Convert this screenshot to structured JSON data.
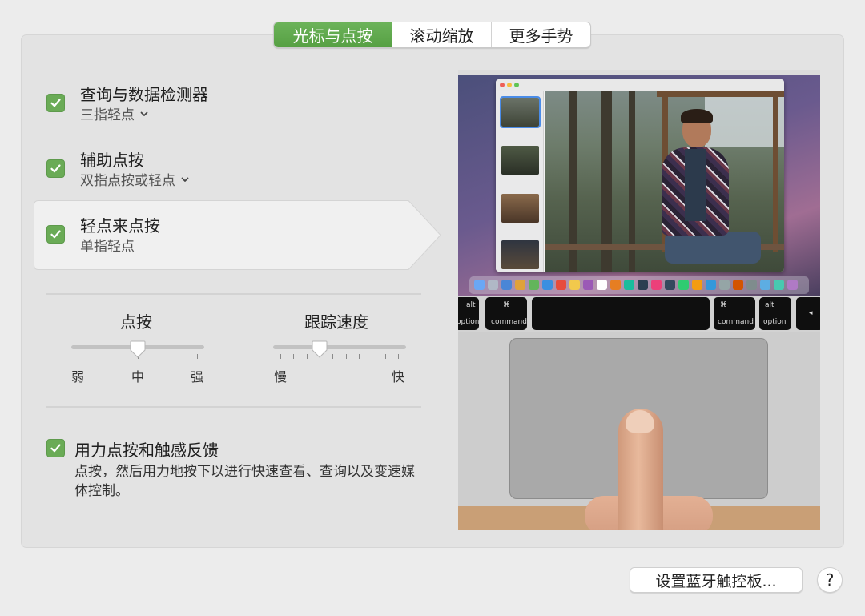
{
  "tabs": [
    {
      "label": "光标与点按",
      "active": true
    },
    {
      "label": "滚动缩放",
      "active": false
    },
    {
      "label": "更多手势",
      "active": false
    }
  ],
  "options": [
    {
      "title": "查询与数据检测器",
      "subtitle": "三指轻点",
      "checked": true,
      "has_dropdown": true
    },
    {
      "title": "辅助点按",
      "subtitle": "双指点按或轻点",
      "checked": true,
      "has_dropdown": true
    },
    {
      "title": "轻点来点按",
      "subtitle": "单指轻点",
      "checked": true,
      "has_dropdown": false,
      "selected": true
    }
  ],
  "click_slider": {
    "title": "点按",
    "labels": [
      "弱",
      "中",
      "强"
    ],
    "value_index": 1,
    "positions": 3
  },
  "tracking_slider": {
    "title": "跟踪速度",
    "labels": [
      "慢",
      "快"
    ],
    "value_index": 3,
    "positions": 10
  },
  "force_click": {
    "title": "用力点按和触感反馈",
    "description": "点按，然后用力地按下以进行快速查看、查询以及变速媒体控制。",
    "checked": true
  },
  "preview": {
    "keys": [
      {
        "top": "alt",
        "bottom": "option"
      },
      {
        "top": "⌘",
        "bottom": "command"
      },
      {
        "top": "",
        "bottom": ""
      },
      {
        "top": "⌘",
        "bottom": "command"
      },
      {
        "top": "alt",
        "bottom": "option"
      },
      {
        "top": "◂",
        "bottom": ""
      }
    ]
  },
  "footer": {
    "bluetooth_label": "设置蓝牙触控板...",
    "help_label": "?"
  },
  "colors": {
    "accent_green": "#5ea64a",
    "checkbox_green": "#6aab56",
    "panel_bg": "#e3e3e3"
  }
}
